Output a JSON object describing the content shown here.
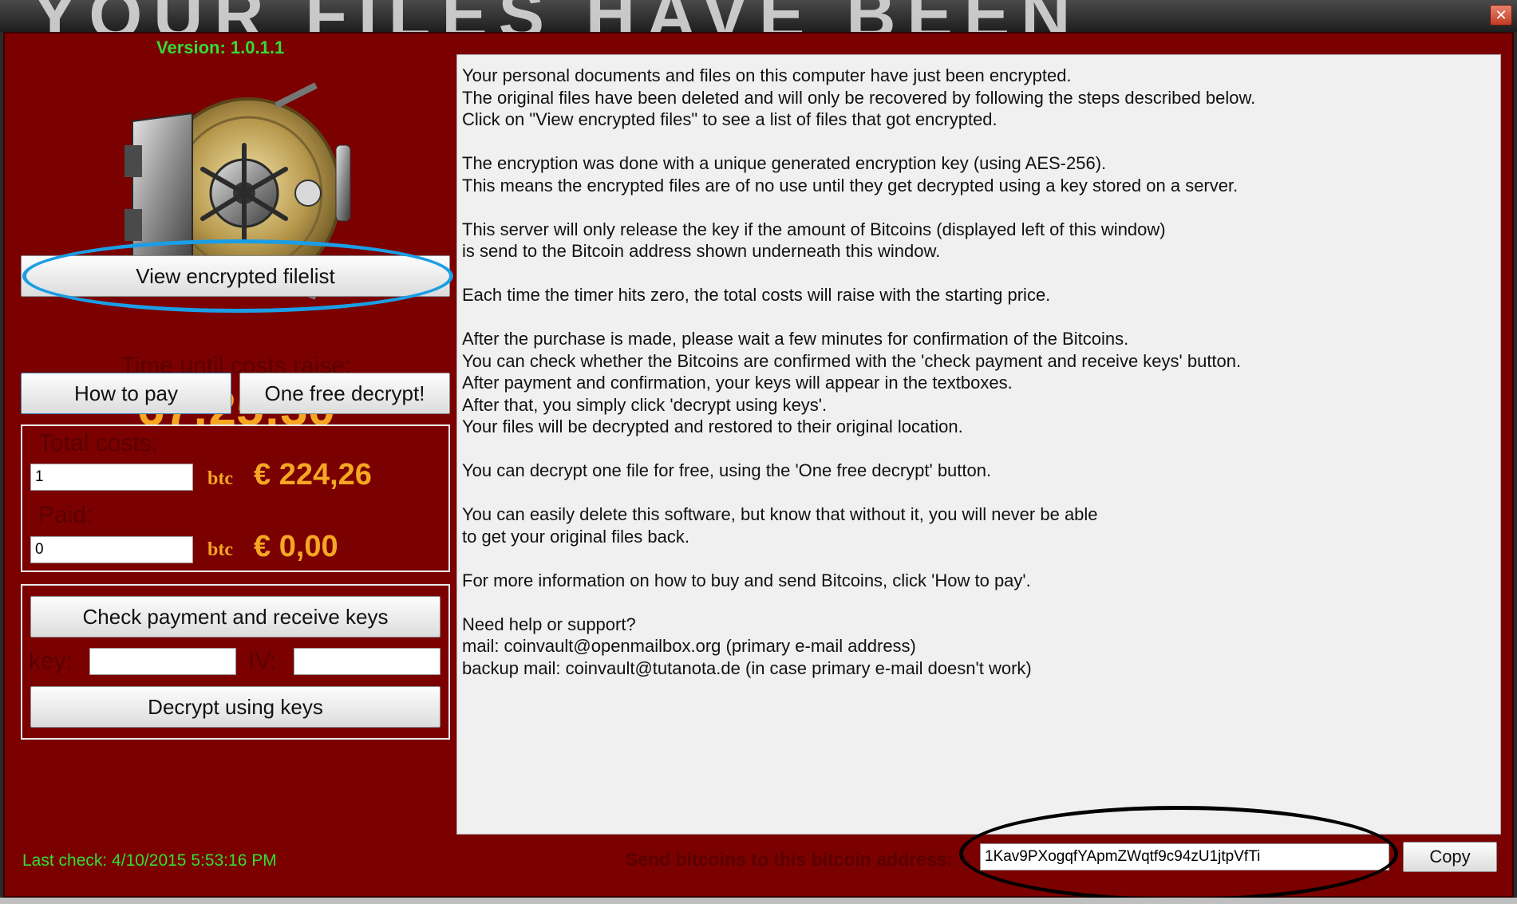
{
  "banner": {
    "text": "YOUR FILES HAVE BEEN"
  },
  "version": "Version: 1.0.1.1",
  "buttons": {
    "view_filelist": "View encrypted filelist",
    "how_to_pay": "How to pay",
    "free_decrypt": "One free decrypt!",
    "check_payment": "Check payment and receive keys",
    "decrypt": "Decrypt using keys",
    "copy": "Copy"
  },
  "timer": {
    "label": "Time until costs raise:",
    "value": "67:25:30"
  },
  "costs": {
    "total_label": "Total costs:",
    "total_btc": "1",
    "total_eur": "€ 224,26",
    "paid_label": "Paid:",
    "paid_btc": "0",
    "paid_eur": "€ 0,00",
    "btc_unit": "btc"
  },
  "keys": {
    "key_label": "key:",
    "iv_label": "IV:",
    "key_value": "",
    "iv_value": ""
  },
  "message": [
    "Your personal documents and files on this computer have just been encrypted.",
    "The original files have been deleted and will only be recovered by following the steps described below.",
    "Click on \"View encrypted files\" to see a list of files that got encrypted.",
    "",
    "The encryption was done with a unique generated encryption key (using AES-256).",
    "This means the encrypted files are of no use until they get decrypted using a key stored on a server.",
    "",
    "This server will only release the key if the amount of Bitcoins (displayed left of this window)",
    "is send to the Bitcoin address shown underneath this window.",
    "",
    "Each time the timer hits zero, the total costs will raise with the starting price.",
    "",
    "After the purchase is made, please wait a few minutes for confirmation of the Bitcoins.",
    "You can check whether the Bitcoins are confirmed with the 'check payment and receive keys' button.",
    "After payment and confirmation, your keys will appear in the textboxes.",
    "After that, you simply click 'decrypt using keys'.",
    "Your files will be decrypted and restored to their original location.",
    "",
    "You can decrypt one file for free, using the 'One free decrypt' button.",
    "",
    "You can easily delete this software, but know that without it, you will never be able",
    "to get your original files back.",
    "",
    "For more information on how to buy and send Bitcoins, click 'How to pay'.",
    "",
    "Need help or support?",
    "mail: coinvault@openmailbox.org (primary e-mail address)",
    "backup mail: coinvault@tutanota.de (in case primary e-mail doesn't work)"
  ],
  "status": {
    "last_check": "Last check: 4/10/2015 5:53:16 PM"
  },
  "bitcoin": {
    "send_label": "Send bitcoins to this bitcoin address:",
    "address": "1Kav9PXogqfYApmZWqtf9c94zU1jtpVfTi"
  },
  "colors": {
    "window_bg": "#7b0000",
    "accent_gold": "#f5a623",
    "status_green": "#33dd33",
    "highlight_blue": "#1a9ee6"
  },
  "icons": {
    "vault": "vault-icon",
    "close": "close-icon"
  }
}
